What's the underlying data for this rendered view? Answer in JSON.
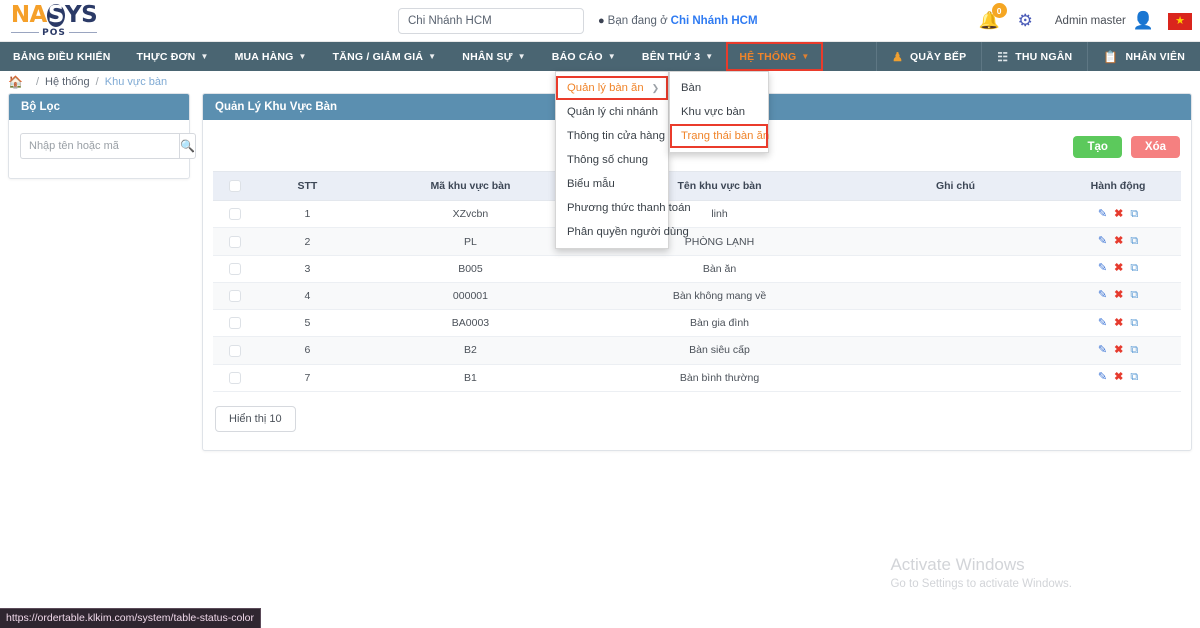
{
  "brand": {
    "part1": "NA",
    "part2": "S",
    "part3": "YS",
    "sub": "POS"
  },
  "topbar": {
    "branch_value": "Chi Nhánh HCM",
    "branch_placeholder": "Chi Nhánh HCM",
    "location_prefix": "Bạn đang ở",
    "location_branch": "Chi Nhánh HCM",
    "notification_count": "0",
    "user_name": "Admin master",
    "flag_glyph": "★"
  },
  "nav": {
    "left_items": [
      {
        "label": "BẢNG ĐIỀU KHIỂN",
        "caret": false,
        "active": false
      },
      {
        "label": "THỰC ĐƠN",
        "caret": true,
        "active": false
      },
      {
        "label": "MUA HÀNG",
        "caret": true,
        "active": false
      },
      {
        "label": "TĂNG / GIẢM GIÁ",
        "caret": true,
        "active": false
      },
      {
        "label": "NHÂN SỰ",
        "caret": true,
        "active": false
      },
      {
        "label": "BÁO CÁO",
        "caret": true,
        "active": false
      },
      {
        "label": "BÊN THỨ 3",
        "caret": true,
        "active": false
      },
      {
        "label": "HỆ THỐNG",
        "caret": true,
        "active": true
      }
    ],
    "right_items": [
      {
        "label": "QUẦY BẾP",
        "icon": "chef-hat-icon"
      },
      {
        "label": "THU NGÂN",
        "icon": "cash-register-icon"
      },
      {
        "label": "NHÂN VIÊN",
        "icon": "clipboard-icon"
      }
    ]
  },
  "dropdown": {
    "items": [
      {
        "label": "Quản lý bàn ăn",
        "has_arrow": true,
        "highlighted": true
      },
      {
        "label": "Quản lý chi nhánh",
        "has_arrow": false,
        "highlighted": false
      },
      {
        "label": "Thông tin cửa hàng",
        "has_arrow": false,
        "highlighted": false
      },
      {
        "label": "Thông số chung",
        "has_arrow": false,
        "highlighted": false
      },
      {
        "label": "Biểu mẫu",
        "has_arrow": false,
        "highlighted": false
      },
      {
        "label": "Phương thức thanh toán",
        "has_arrow": false,
        "highlighted": false
      },
      {
        "label": "Phân quyền người dùng",
        "has_arrow": false,
        "highlighted": false
      }
    ],
    "submenu": [
      {
        "label": "Bàn",
        "highlighted": false
      },
      {
        "label": "Khu vực bàn",
        "highlighted": false
      },
      {
        "label": "Trạng thái bàn ăn",
        "highlighted": true
      }
    ]
  },
  "breadcrumb": {
    "home_icon": "home-icon",
    "items": [
      "Hệ thống",
      "Khu vực bàn"
    ]
  },
  "sidebar": {
    "title": "Bộ Lọc",
    "search_placeholder": "Nhập tên hoặc mã",
    "search_value": ""
  },
  "main": {
    "title": "Quản Lý Khu Vực Bàn",
    "create_label": "Tạo",
    "delete_label": "Xóa",
    "show_label": "Hiển thị 10",
    "columns": [
      "",
      "STT",
      "Mã khu vực bàn",
      "Tên khu vực bàn",
      "Ghi chú",
      "Hành động"
    ],
    "rows": [
      {
        "stt": "1",
        "code": "XZvcbn",
        "name": "linh",
        "note": ""
      },
      {
        "stt": "2",
        "code": "PL",
        "name": "PHÒNG LẠNH",
        "note": ""
      },
      {
        "stt": "3",
        "code": "B005",
        "name": "Bàn ăn",
        "note": ""
      },
      {
        "stt": "4",
        "code": "000001",
        "name": "Bàn không mang về",
        "note": ""
      },
      {
        "stt": "5",
        "code": "BA0003",
        "name": "Bàn gia đình",
        "note": ""
      },
      {
        "stt": "6",
        "code": "B2",
        "name": "Bàn siêu cấp",
        "note": ""
      },
      {
        "stt": "7",
        "code": "B1",
        "name": "Bàn bình thường",
        "note": ""
      }
    ],
    "row_actions": [
      "edit-icon",
      "delete-icon",
      "copy-icon"
    ]
  },
  "watermark": {
    "line1": "Activate Windows",
    "line2": "Go to Settings to activate Windows."
  },
  "statusbar": {
    "url": "https://ordertable.klkim.com/system/table-status-color"
  },
  "colors": {
    "navbar": "#4a6572",
    "panel_header": "#5b8fb0",
    "accent_orange": "#f0842a",
    "highlight_border": "#ea3b2b",
    "create_green": "#5cc95c",
    "delete_red": "#f58080",
    "link_blue": "#2f7bf2"
  }
}
